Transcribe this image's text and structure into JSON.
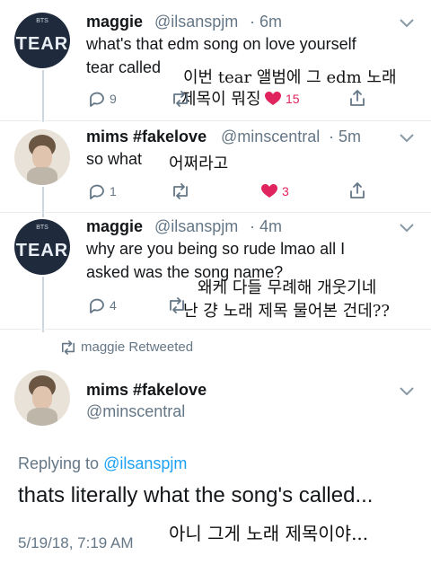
{
  "tweets": [
    {
      "name": "maggie",
      "handle": "@ilsanspjm",
      "time": "· 6m",
      "avatar_text": "TEAR",
      "avatar_small": "BTS",
      "lines": [
        "what's that edm song on love yourself",
        "tear called"
      ],
      "translation": [
        "이번 tear 앨범에 그 edm 노래",
        "제목이 뭐징"
      ],
      "reply_count": "9",
      "retweet_count": "",
      "like_count": "15"
    },
    {
      "name": "mims #fakelove",
      "handle": "@minscentral",
      "time": "· 5m",
      "lines": [
        "so what"
      ],
      "translation": [
        "어쩌라고"
      ],
      "reply_count": "1",
      "retweet_count": "",
      "like_count": "3"
    },
    {
      "name": "maggie",
      "handle": "@ilsanspjm",
      "time": "· 4m",
      "avatar_text": "TEAR",
      "avatar_small": "BTS",
      "lines": [
        "why are you being so rude lmao all I",
        "asked was the song name?"
      ],
      "translation": [
        "왜케 다들 무례해 개웃기네",
        "난 걍 노래 제목 물어본 건데??"
      ],
      "reply_count": "4",
      "retweet_count": "",
      "like_count": ""
    }
  ],
  "retweet_banner": "maggie Retweeted",
  "main_tweet": {
    "name": "mims #fakelove",
    "handle": "@minscentral",
    "replying_label": "Replying to",
    "replying_handle": "@ilsanspjm",
    "text": "thats literally what the song's called...",
    "translation": "아니 그게 노래 제목이야...",
    "timestamp": "5/19/18, 7:19 AM"
  },
  "colors": {
    "muted": "#657786",
    "link": "#1da1f2",
    "like": "#e0245e",
    "divider": "#e6ecf0"
  },
  "icons": [
    "reply-icon",
    "retweet-icon",
    "like-icon",
    "share-icon",
    "chevron-down-icon"
  ]
}
